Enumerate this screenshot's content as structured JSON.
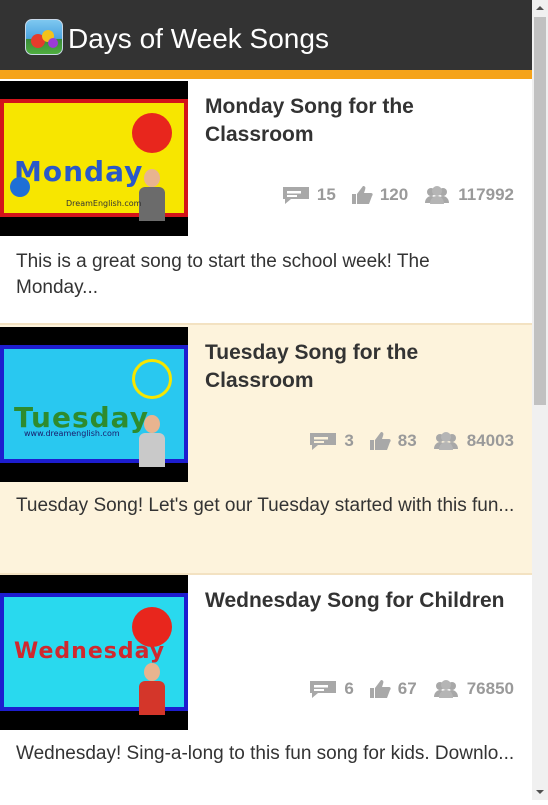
{
  "app": {
    "title": "Days of Week Songs",
    "icon": "fruit-app-icon"
  },
  "colors": {
    "appbar": "#333333",
    "accent": "#f5a31a",
    "alt_row": "#fdf3dc",
    "stat_gray": "#9a9a9a"
  },
  "videos": [
    {
      "title": "Monday Song for the Classroom",
      "thumb_word": "Monday",
      "thumb_site": "DreamEnglish.com",
      "comments": "15",
      "likes": "120",
      "views": "117992",
      "description": "This is a great song to start the school week! The Monday..."
    },
    {
      "title": "Tuesday Song for the Classroom",
      "thumb_word": "Tuesday",
      "thumb_site": "www.dreamenglish.com",
      "comments": "3",
      "likes": "83",
      "views": "84003",
      "description": "Tuesday Song! Let's get our Tuesday started with this fun..."
    },
    {
      "title": "Wednesday Song for Children",
      "thumb_word": "Wednesday",
      "thumb_site": "",
      "comments": "6",
      "likes": "67",
      "views": "76850",
      "description": "Wednesday! Sing-a-long to this fun song for kids. Downlo..."
    }
  ]
}
